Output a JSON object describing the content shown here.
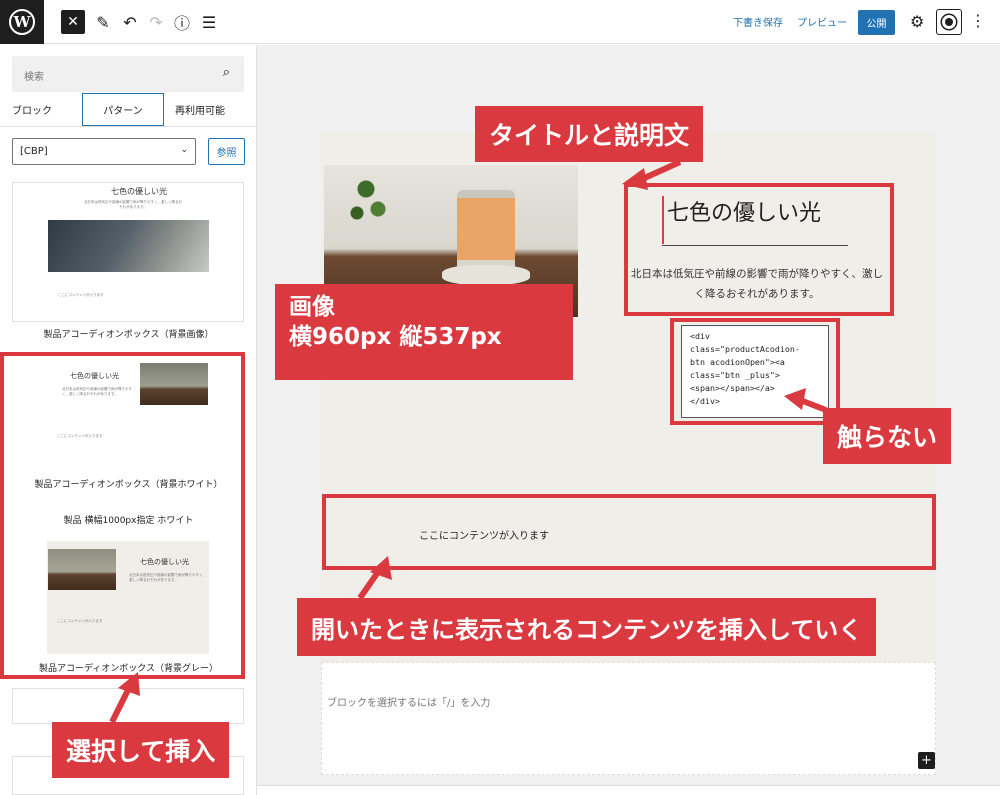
{
  "toolbar": {
    "save_draft": "下書き保存",
    "preview": "プレビュー",
    "publish": "公開"
  },
  "sidebar": {
    "search_placeholder": "検索",
    "tabs": [
      "ブロック",
      "パターン",
      "再利用可能"
    ],
    "category_select": "[CBP]",
    "browse_button": "参照",
    "patterns": [
      {
        "label": "製品アコーディオンボックス（背景画像）",
        "mini_title": "七色の優しい光",
        "mini_text": "北日本は低気圧や前線の影響で雨が降りやすく、激しく降るおそれがあります。",
        "mini_content": "ここにコンテンツが入ります"
      },
      {
        "label": "製品アコーディオンボックス（背景ホワイト）",
        "mini_title": "七色の優しい光",
        "mini_text": "北日本は低気圧や前線の影響で雨が降りやすく、激しく降るおそれがあります。",
        "mini_content": "ここにコンテンツが入ります"
      },
      {
        "label": "製品 横幅1000px指定 ホワイト"
      },
      {
        "label": "製品アコーディオンボックス（背景グレー）",
        "mini_title": "七色の優しい光",
        "mini_text": "北日本は低気圧や前線の影響で雨が降りやすく、激しく降るおそれがあります。",
        "mini_content": "ここにコンテンツが入ります"
      }
    ]
  },
  "editor": {
    "heading": "七色の優しい光",
    "description": "北日本は低気圧や前線の影響で雨が降りやすく、激しく降るおそれがあります。",
    "code": "<div\nclass=\"productAcodion-\nbtn acodionOpen\"><a\nclass=\"btn _plus\">\n<span></span></a>\n</div>",
    "content_placeholder": "ここにコンテンツが入ります",
    "block_hint": "ブロックを選択するには「/」を入力"
  },
  "annotations": {
    "title_desc": "タイトルと説明文",
    "image_line1": "画像",
    "image_line2": "横960px 縦537px",
    "dont_touch": "触らない",
    "insert_content": "開いたときに表示されるコンテンツを挿入していく",
    "select_insert": "選択して挿入"
  },
  "colors": {
    "accent": "#d9393f",
    "wp_blue": "#2271b1",
    "page_bg": "#f0eee8"
  },
  "icons": [
    "wordpress-logo-icon",
    "close-icon",
    "pencil-icon",
    "undo-icon",
    "redo-icon",
    "info-icon",
    "list-view-icon",
    "gear-icon",
    "more-vertical-icon",
    "search-icon",
    "chevron-down-icon",
    "plus-icon"
  ]
}
